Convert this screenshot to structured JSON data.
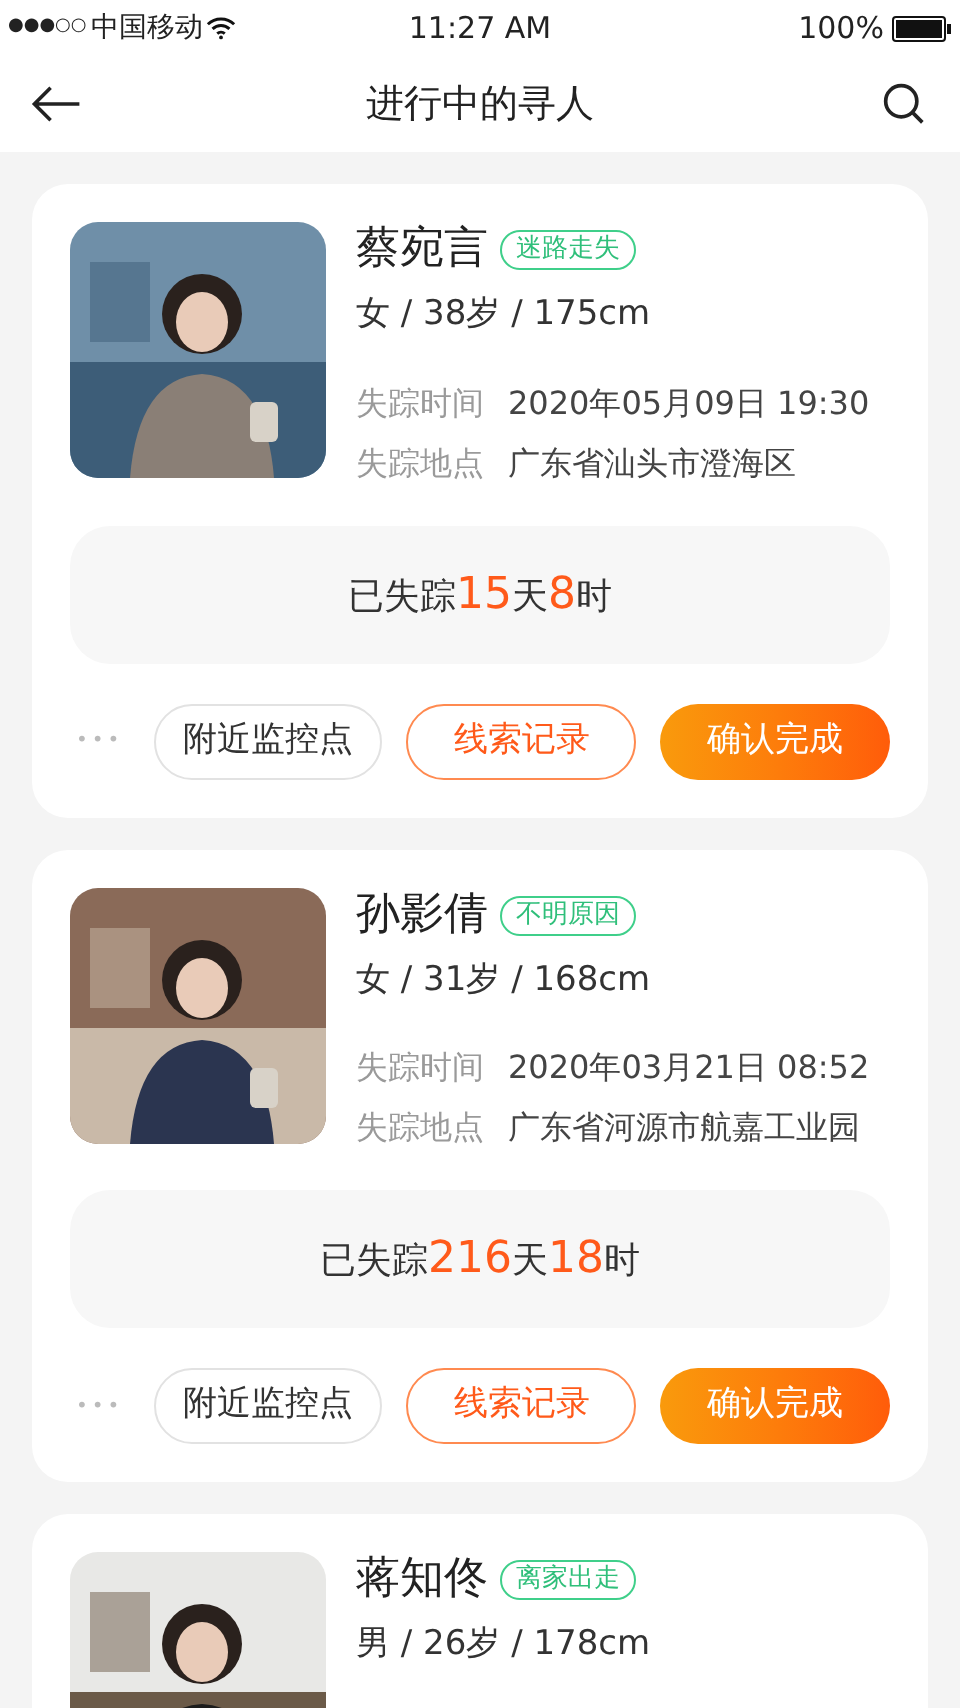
{
  "status_bar": {
    "signal": "●●●○○",
    "carrier": "中国移动",
    "time": "11:27 AM",
    "battery": "100%"
  },
  "nav": {
    "title": "进行中的寻人"
  },
  "cases": [
    {
      "photo": {
        "kind": "picture"
      },
      "name": "蔡宛言",
      "tag": "迷路走失",
      "info": "女 / 38岁 / 175cm",
      "details": [
        {
          "label": "失踪时间",
          "value": "2020年05月09日 19:30"
        },
        {
          "label": "失踪地点",
          "value": "广东省汕头市澄海区"
        }
      ],
      "duration": {
        "prefix": "已失踪",
        "days": "15",
        "day_unit": "天",
        "hours": "8",
        "hour_unit": "时"
      },
      "actions": {
        "more": "•••",
        "monitor": "附近监控点",
        "clues": "线索记录",
        "confirm": "确认完成"
      }
    },
    {
      "photo": {
        "kind": "picture"
      },
      "name": "孙影倩",
      "tag": "不明原因",
      "info": "女 / 31岁 / 168cm",
      "details": [
        {
          "label": "失踪时间",
          "value": "2020年03月21日 08:52"
        },
        {
          "label": "失踪地点",
          "value": "广东省河源市航嘉工业园"
        }
      ],
      "duration": {
        "prefix": "已失踪",
        "days": "216",
        "day_unit": "天",
        "hours": "18",
        "hour_unit": "时"
      },
      "actions": {
        "more": "•••",
        "monitor": "附近监控点",
        "clues": "线索记录",
        "confirm": "确认完成"
      }
    },
    {
      "photo": {
        "kind": "picture"
      },
      "name": "蒋知佟",
      "tag": "离家出走",
      "info": "男 / 26岁 / 178cm"
    }
  ]
}
